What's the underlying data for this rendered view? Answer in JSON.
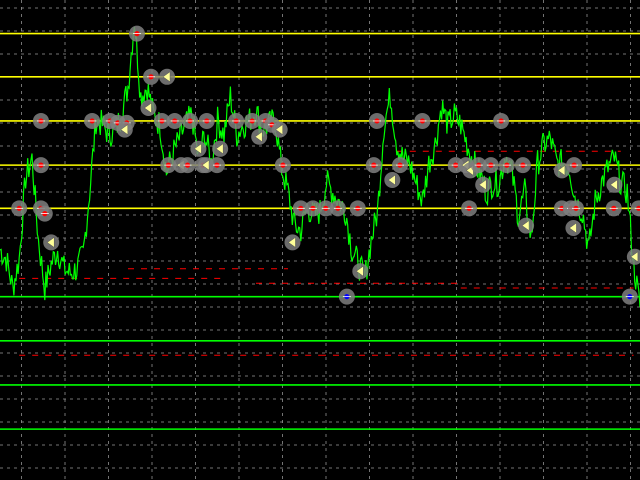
{
  "chart_data": {
    "type": "line",
    "title": "",
    "xlabel": "",
    "ylabel": "",
    "xlim": [
      0,
      100
    ],
    "ylim": [
      0,
      100
    ],
    "grid": true,
    "legend": "none",
    "colors": {
      "background": "#000000",
      "grid": "#9a9a9a",
      "price": "#00ff00",
      "resistance": "#ffff00",
      "support": "#00ff00",
      "marker_ring": "#7f7f7f",
      "marker_center": "#ff0000",
      "marker_center_support": "#0000ff",
      "marker_arrow": "#ffff99",
      "dash": "#ff0000"
    },
    "horizontal_levels": [
      {
        "kind": "resistance",
        "y": 93.0
      },
      {
        "kind": "resistance",
        "y": 84.0
      },
      {
        "kind": "resistance",
        "y": 74.8
      },
      {
        "kind": "resistance",
        "y": 65.6
      },
      {
        "kind": "resistance",
        "y": 56.6
      },
      {
        "kind": "support",
        "y": 38.2
      },
      {
        "kind": "support",
        "y": 29.0
      },
      {
        "kind": "support",
        "y": 19.8
      },
      {
        "kind": "support",
        "y": 10.6
      }
    ],
    "dashed_levels": [
      {
        "x": [
          3,
          35
        ],
        "y": 42.0
      },
      {
        "x": [
          20,
          45
        ],
        "y": 44.0
      },
      {
        "x": [
          40,
          72
        ],
        "y": 41.0
      },
      {
        "x": [
          72,
          99
        ],
        "y": 40.0
      },
      {
        "x": [
          3,
          50
        ],
        "y": 26.0
      },
      {
        "x": [
          50,
          99
        ],
        "y": 26.0
      },
      {
        "x": [
          62,
          97
        ],
        "y": 68.5
      }
    ],
    "price_series": {
      "x": [
        0,
        1,
        2,
        3,
        4,
        5,
        6,
        7,
        8,
        9,
        10,
        11,
        12,
        13,
        14,
        15,
        16,
        17,
        18,
        19,
        20,
        21,
        22,
        23,
        24,
        25,
        26,
        27,
        28,
        29,
        30,
        31,
        32,
        33,
        34,
        35,
        36,
        37,
        38,
        39,
        40,
        41,
        42,
        43,
        44,
        45,
        46,
        47,
        48,
        49,
        50,
        51,
        52,
        53,
        54,
        55,
        56,
        57,
        58,
        59,
        60,
        61,
        62,
        63,
        64,
        65,
        66,
        67,
        68,
        69,
        70,
        71,
        72,
        73,
        74,
        75,
        76,
        77,
        78,
        79,
        80,
        81,
        82,
        83,
        84,
        85,
        86,
        87,
        88,
        89,
        90,
        91,
        92,
        93,
        94,
        95,
        96,
        97,
        98,
        99,
        100
      ],
      "y": [
        48,
        46,
        40,
        46,
        63,
        67,
        50,
        40,
        45,
        48,
        44,
        43,
        44,
        47,
        60,
        75,
        74,
        72,
        73,
        76,
        82,
        96,
        80,
        82,
        76,
        74,
        64,
        68,
        71,
        74,
        76,
        67,
        72,
        66,
        75,
        72,
        80,
        72,
        74,
        75,
        77,
        73,
        74,
        75,
        65,
        60,
        53,
        52,
        57,
        55,
        56,
        62,
        60,
        58,
        56,
        48,
        45,
        42,
        50,
        56,
        74,
        80,
        70,
        67,
        66,
        62,
        58,
        66,
        70,
        78,
        74,
        76,
        74,
        70,
        66,
        64,
        60,
        62,
        62,
        68,
        64,
        55,
        60,
        50,
        66,
        70,
        71,
        66,
        66,
        65,
        58,
        56,
        48,
        58,
        62,
        65,
        67,
        62,
        60,
        45,
        36
      ]
    },
    "markers": [
      {
        "x": 6.4,
        "y": 74.8,
        "type": "point"
      },
      {
        "x": 6.4,
        "y": 65.6,
        "type": "point"
      },
      {
        "x": 3.0,
        "y": 56.6,
        "type": "point"
      },
      {
        "x": 6.4,
        "y": 56.6,
        "type": "point"
      },
      {
        "x": 7.0,
        "y": 55.5,
        "type": "point"
      },
      {
        "x": 8.0,
        "y": 49.5,
        "type": "arrow"
      },
      {
        "x": 21.4,
        "y": 93.0,
        "type": "point"
      },
      {
        "x": 23.6,
        "y": 84.0,
        "type": "point"
      },
      {
        "x": 26.1,
        "y": 84.0,
        "type": "arrow"
      },
      {
        "x": 23.2,
        "y": 77.5,
        "type": "arrow"
      },
      {
        "x": 14.4,
        "y": 74.8,
        "type": "point"
      },
      {
        "x": 17.2,
        "y": 74.8,
        "type": "point"
      },
      {
        "x": 18.4,
        "y": 74.4,
        "type": "point"
      },
      {
        "x": 19.8,
        "y": 74.4,
        "type": "point"
      },
      {
        "x": 19.5,
        "y": 73.0,
        "type": "arrow"
      },
      {
        "x": 25.3,
        "y": 74.8,
        "type": "point"
      },
      {
        "x": 27.3,
        "y": 74.8,
        "type": "point"
      },
      {
        "x": 29.7,
        "y": 74.8,
        "type": "point"
      },
      {
        "x": 32.3,
        "y": 74.8,
        "type": "point"
      },
      {
        "x": 36.9,
        "y": 74.8,
        "type": "point"
      },
      {
        "x": 39.4,
        "y": 74.8,
        "type": "point"
      },
      {
        "x": 41.5,
        "y": 74.8,
        "type": "point"
      },
      {
        "x": 42.5,
        "y": 74.0,
        "type": "point"
      },
      {
        "x": 43.7,
        "y": 73.0,
        "type": "arrow"
      },
      {
        "x": 40.5,
        "y": 71.5,
        "type": "arrow"
      },
      {
        "x": 31.0,
        "y": 69.0,
        "type": "arrow"
      },
      {
        "x": 34.4,
        "y": 69.0,
        "type": "arrow"
      },
      {
        "x": 26.3,
        "y": 65.6,
        "type": "point"
      },
      {
        "x": 28.3,
        "y": 65.6,
        "type": "arrow"
      },
      {
        "x": 29.3,
        "y": 65.6,
        "type": "point"
      },
      {
        "x": 31.7,
        "y": 65.6,
        "type": "point"
      },
      {
        "x": 32.2,
        "y": 65.6,
        "type": "arrow"
      },
      {
        "x": 33.9,
        "y": 65.6,
        "type": "point"
      },
      {
        "x": 44.2,
        "y": 65.6,
        "type": "point"
      },
      {
        "x": 47.0,
        "y": 56.6,
        "type": "point"
      },
      {
        "x": 48.9,
        "y": 56.6,
        "type": "point"
      },
      {
        "x": 50.9,
        "y": 56.6,
        "type": "point"
      },
      {
        "x": 52.8,
        "y": 56.6,
        "type": "point"
      },
      {
        "x": 45.7,
        "y": 49.5,
        "type": "arrow"
      },
      {
        "x": 55.9,
        "y": 56.6,
        "type": "point"
      },
      {
        "x": 58.9,
        "y": 74.8,
        "type": "point"
      },
      {
        "x": 66.0,
        "y": 74.8,
        "type": "point"
      },
      {
        "x": 78.3,
        "y": 74.8,
        "type": "point"
      },
      {
        "x": 58.4,
        "y": 65.6,
        "type": "point"
      },
      {
        "x": 62.5,
        "y": 65.6,
        "type": "point"
      },
      {
        "x": 61.3,
        "y": 62.5,
        "type": "arrow"
      },
      {
        "x": 71.2,
        "y": 65.6,
        "type": "point"
      },
      {
        "x": 72.8,
        "y": 65.6,
        "type": "arrow"
      },
      {
        "x": 73.5,
        "y": 64.5,
        "type": "arrow"
      },
      {
        "x": 74.8,
        "y": 65.6,
        "type": "point"
      },
      {
        "x": 76.7,
        "y": 65.6,
        "type": "point"
      },
      {
        "x": 75.5,
        "y": 61.5,
        "type": "arrow"
      },
      {
        "x": 79.2,
        "y": 65.6,
        "type": "point"
      },
      {
        "x": 81.7,
        "y": 65.6,
        "type": "point"
      },
      {
        "x": 87.8,
        "y": 64.5,
        "type": "arrow"
      },
      {
        "x": 89.7,
        "y": 65.6,
        "type": "point"
      },
      {
        "x": 73.3,
        "y": 56.6,
        "type": "point"
      },
      {
        "x": 82.2,
        "y": 53.0,
        "type": "arrow"
      },
      {
        "x": 87.8,
        "y": 56.6,
        "type": "point"
      },
      {
        "x": 89.2,
        "y": 56.6,
        "type": "point"
      },
      {
        "x": 90.0,
        "y": 56.6,
        "type": "point"
      },
      {
        "x": 89.6,
        "y": 52.5,
        "type": "arrow"
      },
      {
        "x": 96.0,
        "y": 61.5,
        "type": "arrow"
      },
      {
        "x": 95.9,
        "y": 56.6,
        "type": "point"
      },
      {
        "x": 99.8,
        "y": 56.6,
        "type": "point"
      },
      {
        "x": 99.2,
        "y": 46.5,
        "type": "arrow"
      },
      {
        "x": 56.3,
        "y": 43.5,
        "type": "arrow"
      },
      {
        "x": 54.2,
        "y": 38.2,
        "type": "point-support"
      },
      {
        "x": 98.4,
        "y": 38.2,
        "type": "point-support"
      }
    ]
  }
}
